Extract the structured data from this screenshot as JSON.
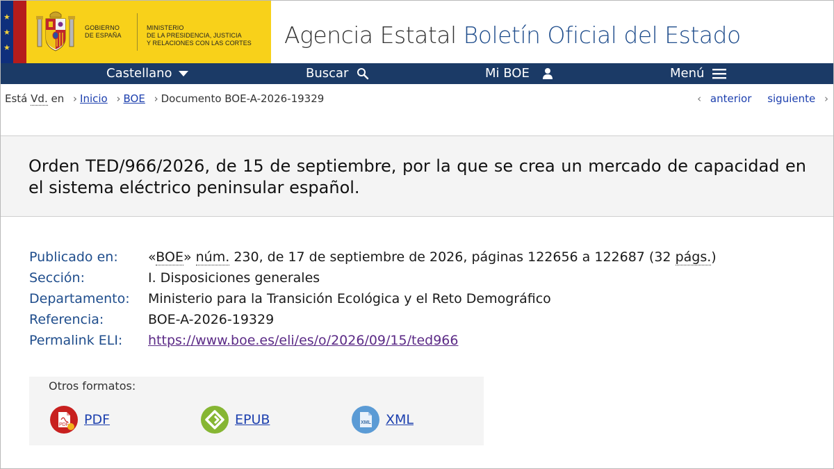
{
  "header": {
    "gobierno_line1": "GOBIERNO",
    "gobierno_line2": "DE ESPAÑA",
    "ministerio_line1": "MINISTERIO",
    "ministerio_line2": "DE LA PRESIDENCIA, JUSTICIA",
    "ministerio_line3": "Y RELACIONES CON LAS CORTES",
    "agency_part1": "Agencia Estatal",
    "agency_part2": "Boletín Oficial del Estado"
  },
  "nav": {
    "language": "Castellano",
    "search": "Buscar",
    "my_boe": "Mi BOE",
    "menu": "Menú"
  },
  "breadcrumb": {
    "prefix_1": "Está",
    "prefix_abbr": "Vd.",
    "prefix_2": "en",
    "home": "Inicio",
    "boe": "BOE",
    "current": "Documento BOE-A-2026-19329"
  },
  "pager": {
    "previous": "anterior",
    "next": "siguiente"
  },
  "document": {
    "title": "Orden TED/966/2026, de 15 de septiembre, por la que se crea un mercado de capacidad en el sistema eléctrico peninsular español."
  },
  "meta": {
    "published_label": "Publicado en:",
    "published_open": "«",
    "published_boe": "BOE",
    "published_close": "» ",
    "published_num_abbr": "núm.",
    "published_rest": " 230, de 17 de septiembre de 2026, páginas 122656 a 122687 (32 ",
    "published_pags_abbr": "págs.",
    "published_end": ")",
    "section_label": "Sección:",
    "section_value": "I. Disposiciones generales",
    "department_label": "Departamento:",
    "department_value": "Ministerio para la Transición Ecológica y el Reto Demográfico",
    "reference_label": "Referencia:",
    "reference_value": "BOE-A-2026-19329",
    "eli_label": "Permalink ELI:",
    "eli_value": "https://www.boe.es/eli/es/o/2026/09/15/ted966"
  },
  "formats": {
    "title": "Otros formatos:",
    "items": [
      {
        "label": "PDF",
        "icon": "pdf-icon",
        "color": "#c8201f"
      },
      {
        "label": "EPUB",
        "icon": "epub-icon",
        "color": "#86b633"
      },
      {
        "label": "XML",
        "icon": "xml-icon",
        "color": "#5b9bd5"
      }
    ]
  },
  "colors": {
    "navbar": "#1b3a66",
    "brand_yellow": "#f8d11a",
    "brand_red": "#b51c1c",
    "eu_blue": "#0f2f7c",
    "link": "#1c3fae",
    "label_blue": "#1f4d8c"
  }
}
